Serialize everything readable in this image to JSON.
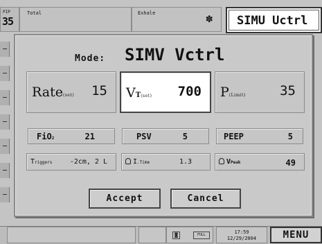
{
  "monitor": {
    "pip_label": "PIP",
    "pip_value": "35",
    "total_label": "Total",
    "exhale_label": "Exhale",
    "mode_display": "SIMU Uctrl"
  },
  "dialog": {
    "mode_label": "Mode:",
    "mode_value": "SIMV Vctrl",
    "rate": {
      "label": "Rate",
      "sub": "(set)",
      "value": "15"
    },
    "vt": {
      "label": "V",
      "label_sub": "T",
      "sub": "(set)",
      "value": "700"
    },
    "plimit": {
      "label": "P",
      "sub": "(Limit)",
      "value": "35"
    },
    "fio2": {
      "label": "FiO",
      "sub": "2",
      "value": "21"
    },
    "psv": {
      "label": "PSV",
      "value": "5"
    },
    "peep": {
      "label": "PEEP",
      "value": "5"
    },
    "triggers": {
      "label": "T",
      "label_rest": "riggers",
      "value": "-2cm, 2 L"
    },
    "itime": {
      "label": "I",
      "sub": ".Time",
      "value": "1.3"
    },
    "vpeak": {
      "label": "V",
      "sub": "Peak",
      "value": "49"
    },
    "accept_label": "Accept",
    "cancel_label": "Cancel"
  },
  "statusbar": {
    "battery_label": "FULL",
    "time": "17:59",
    "date": "12/29/2004",
    "menu_label": "MENU"
  }
}
